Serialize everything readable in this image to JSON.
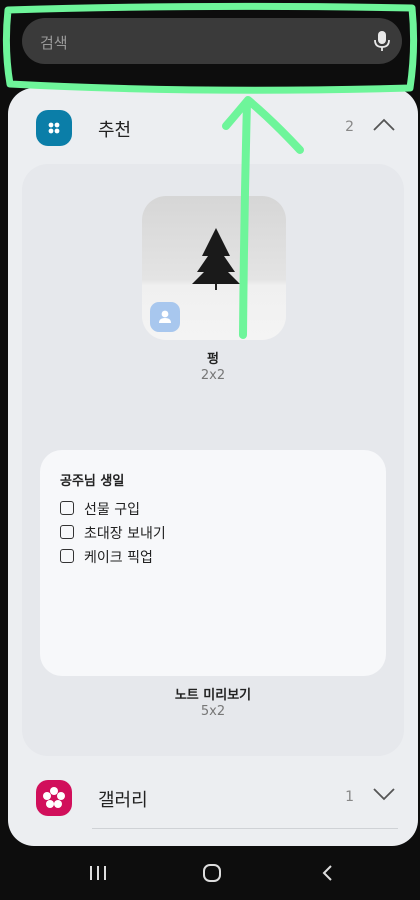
{
  "search": {
    "placeholder": "검색",
    "mic_icon": "microphone-icon"
  },
  "sections": [
    {
      "title": "추천",
      "count": "2",
      "icon": "widgets-icon",
      "icon_color": "#0b7ea8",
      "expanded": true
    },
    {
      "title": "갤러리",
      "count": "1",
      "icon": "flower-icon",
      "icon_color": "#d10f5b",
      "expanded": false
    }
  ],
  "widgets": [
    {
      "title": "펑",
      "size": "2x2"
    },
    {
      "title": "노트 미리보기",
      "size": "5x2"
    }
  ],
  "note": {
    "heading": "공주님 생일",
    "items": [
      {
        "label": "선물 구입",
        "checked": false
      },
      {
        "label": "초대장 보내기",
        "checked": false
      },
      {
        "label": "케이크 픽업",
        "checked": false
      }
    ]
  },
  "nav": {
    "recent": "recent-apps-icon",
    "home": "home-icon",
    "back": "back-icon"
  },
  "colors": {
    "annotation": "#6ef59a",
    "panel": "#eceef1"
  }
}
